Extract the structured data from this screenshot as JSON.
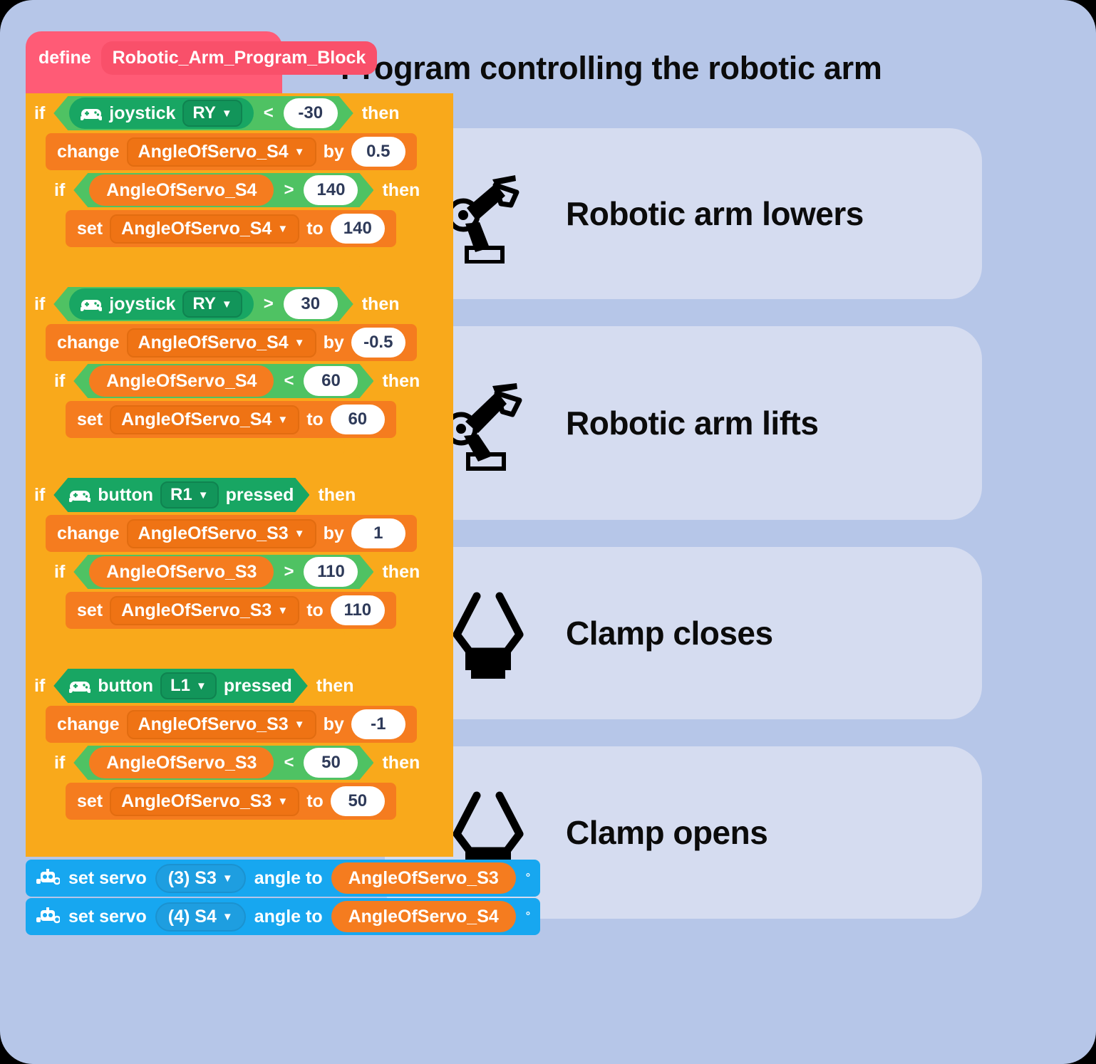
{
  "page": {
    "title": "Program controlling the robotic arm",
    "background_color": "#b6c6e8",
    "card_color": "#d5dcf0"
  },
  "program": {
    "define": {
      "keyword": "define",
      "name": "Robotic_Arm_Program_Block"
    },
    "sections": [
      {
        "id": "arm-lowers",
        "condition": {
          "if_label": "if",
          "then_label": "then",
          "sensor": "joystick",
          "dropdown": "RY",
          "operator": "<",
          "value": "-30"
        },
        "change": {
          "keyword": "change",
          "variable": "AngleOfServo_S4",
          "by_label": "by",
          "amount": "0.5"
        },
        "inner_if": {
          "if_label": "if",
          "then_label": "then",
          "variable": "AngleOfServo_S4",
          "operator": ">",
          "value": "140"
        },
        "set": {
          "keyword": "set",
          "variable": "AngleOfServo_S4",
          "to_label": "to",
          "value": "140"
        }
      },
      {
        "id": "arm-lifts",
        "condition": {
          "if_label": "if",
          "then_label": "then",
          "sensor": "joystick",
          "dropdown": "RY",
          "operator": ">",
          "value": "30"
        },
        "change": {
          "keyword": "change",
          "variable": "AngleOfServo_S4",
          "by_label": "by",
          "amount": "-0.5"
        },
        "inner_if": {
          "if_label": "if",
          "then_label": "then",
          "variable": "AngleOfServo_S4",
          "operator": "<",
          "value": "60"
        },
        "set": {
          "keyword": "set",
          "variable": "AngleOfServo_S4",
          "to_label": "to",
          "value": "60"
        }
      },
      {
        "id": "clamp-closes",
        "condition": {
          "if_label": "if",
          "then_label": "then",
          "sensor": "button",
          "dropdown": "R1",
          "state": "pressed"
        },
        "change": {
          "keyword": "change",
          "variable": "AngleOfServo_S3",
          "by_label": "by",
          "amount": "1"
        },
        "inner_if": {
          "if_label": "if",
          "then_label": "then",
          "variable": "AngleOfServo_S3",
          "operator": ">",
          "value": "110"
        },
        "set": {
          "keyword": "set",
          "variable": "AngleOfServo_S3",
          "to_label": "to",
          "value": "110"
        }
      },
      {
        "id": "clamp-opens",
        "condition": {
          "if_label": "if",
          "then_label": "then",
          "sensor": "button",
          "dropdown": "L1",
          "state": "pressed"
        },
        "change": {
          "keyword": "change",
          "variable": "AngleOfServo_S3",
          "by_label": "by",
          "amount": "-1"
        },
        "inner_if": {
          "if_label": "if",
          "then_label": "then",
          "variable": "AngleOfServo_S3",
          "operator": "<",
          "value": "50"
        },
        "set": {
          "keyword": "set",
          "variable": "AngleOfServo_S3",
          "to_label": "to",
          "value": "50"
        }
      }
    ],
    "servo_blocks": [
      {
        "keyword": "set servo",
        "port": "(3) S3",
        "angle_label": "angle to",
        "value": "AngleOfServo_S3",
        "unit": "°"
      },
      {
        "keyword": "set servo",
        "port": "(4) S4",
        "angle_label": "angle to",
        "value": "AngleOfServo_S4",
        "unit": "°"
      }
    ]
  },
  "cards": [
    {
      "icon": "robot-arm-lowers-icon",
      "label": "Robotic arm lowers"
    },
    {
      "icon": "robot-arm-lifts-icon",
      "label": "Robotic arm lifts"
    },
    {
      "icon": "clamp-closed-icon",
      "label": "Clamp closes"
    },
    {
      "icon": "clamp-open-icon",
      "label": "Clamp opens"
    }
  ],
  "icons": {
    "gamepad": "gamepad-icon",
    "robot_head": "robot-head-icon",
    "caret": "▼"
  }
}
